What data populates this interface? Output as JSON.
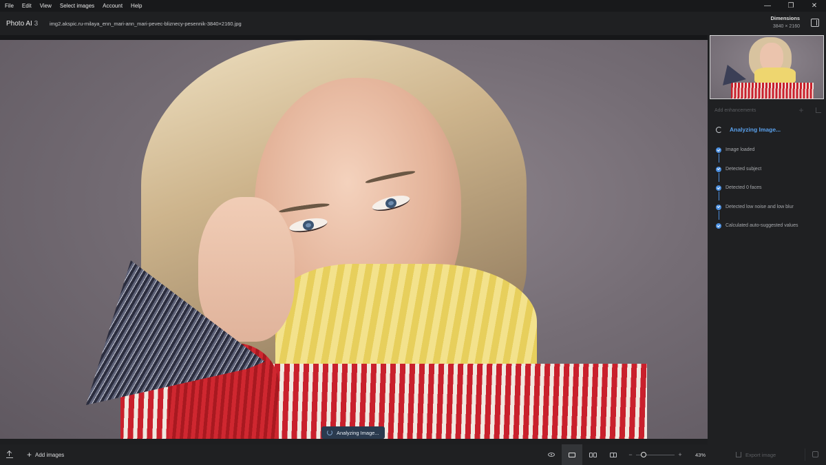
{
  "menu": {
    "items": [
      {
        "label": "File"
      },
      {
        "label": "Edit"
      },
      {
        "label": "View"
      },
      {
        "label": "Select images"
      },
      {
        "label": "Account"
      },
      {
        "label": "Help"
      }
    ],
    "window_controls": {
      "minimize": "—",
      "maximize": "❐",
      "close": "✕"
    }
  },
  "header": {
    "app_name": "Photo AI",
    "app_version": "3",
    "filename": "img2.akspic.ru-milaya_enn_mari-ann_mari-pevec-bliznecy-pesennik-3840×2160.jpg",
    "dimensions_label": "Dimensions",
    "dimensions_value": "3840 × 2160"
  },
  "canvas": {
    "toast_text": "Analyzing Image..."
  },
  "panel": {
    "add_enhancements": "Add enhancements",
    "add_icon": "+",
    "analyzing_title": "Analyzing Image...",
    "steps": [
      {
        "label": "Image loaded"
      },
      {
        "label": "Detected subject"
      },
      {
        "label": "Detected 0 faces"
      },
      {
        "label": "Detected low noise and low blur"
      },
      {
        "label": "Calculated auto-suggested values"
      }
    ],
    "accent_color": "#4b8fe0"
  },
  "bottom": {
    "add_images": "Add images",
    "plus_icon": "+",
    "zoom_minus": "−",
    "zoom_plus": "+",
    "zoom_value": "43%",
    "zoom_fraction": 0.2,
    "export_label": "Export image"
  }
}
